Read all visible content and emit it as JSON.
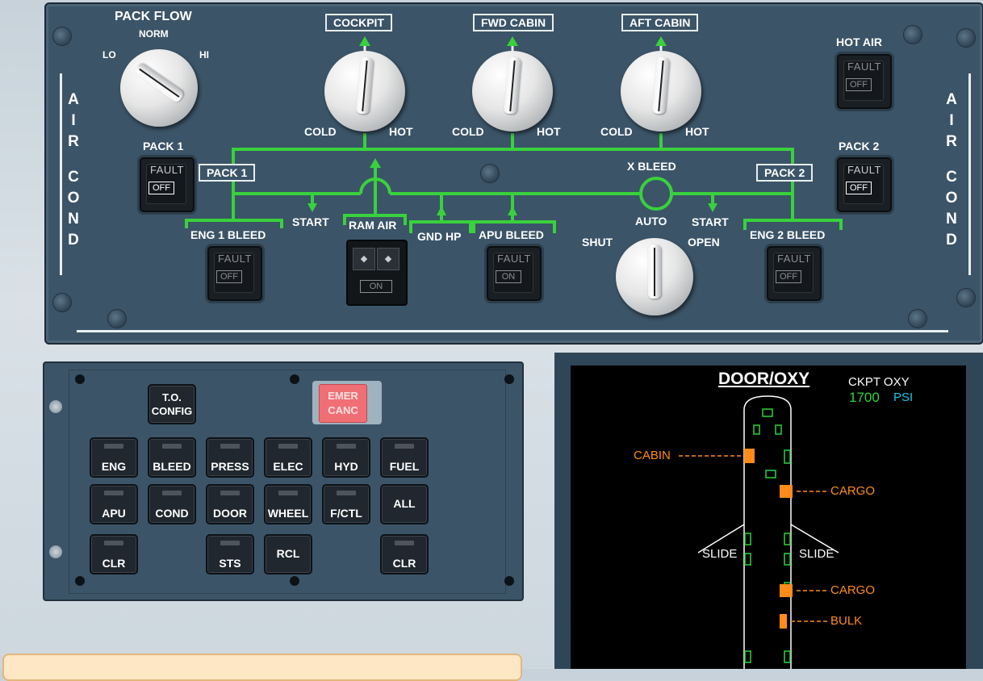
{
  "overhead": {
    "pack_flow": {
      "title": "PACK FLOW",
      "lo": "LO",
      "norm": "NORM",
      "hi": "HI"
    },
    "zones": [
      {
        "name": "COCKPIT",
        "cold": "COLD",
        "hot": "HOT"
      },
      {
        "name": "FWD CABIN",
        "cold": "COLD",
        "hot": "HOT"
      },
      {
        "name": "AFT CABIN",
        "cold": "COLD",
        "hot": "HOT"
      }
    ],
    "hot_air": {
      "label": "HOT AIR",
      "fault": "FAULT",
      "state": "OFF"
    },
    "pack1": {
      "label": "PACK 1",
      "fault": "FAULT",
      "state": "OFF",
      "box_label": "PACK 1"
    },
    "pack2": {
      "label": "PACK 2",
      "fault": "FAULT",
      "state": "OFF",
      "box_label": "PACK 2"
    },
    "side_left": [
      "A",
      "I",
      "R",
      "C",
      "O",
      "N",
      "D"
    ],
    "side_right": [
      "A",
      "I",
      "R",
      "C",
      "O",
      "N",
      "D"
    ],
    "x_bleed": {
      "label": "X BLEED",
      "shut": "SHUT",
      "auto": "AUTO",
      "open": "OPEN"
    },
    "start_left": "START",
    "start_right": "START",
    "eng1_bleed": {
      "label": "ENG 1 BLEED",
      "fault": "FAULT",
      "state": "OFF"
    },
    "ram_air": {
      "label": "RAM AIR",
      "state": "ON"
    },
    "gnd_hp": {
      "label": "GND HP"
    },
    "apu_bleed": {
      "label": "APU BLEED",
      "fault": "FAULT",
      "state": "ON"
    },
    "eng2_bleed": {
      "label": "ENG 2 BLEED",
      "fault": "FAULT",
      "state": "OFF"
    },
    "duct_color": "#39d13c"
  },
  "ecam_panel": {
    "to_config": [
      "T.O.",
      "CONFIG"
    ],
    "emer_canc": [
      "EMER",
      "CANC"
    ],
    "row1": [
      "ENG",
      "BLEED",
      "PRESS",
      "ELEC",
      "HYD",
      "FUEL"
    ],
    "row2": [
      "APU",
      "COND",
      "DOOR",
      "WHEEL",
      "F/CTL",
      "ALL"
    ],
    "row3": {
      "clr_left": "CLR",
      "sts": "STS",
      "rcl": "RCL",
      "clr_right": "CLR"
    }
  },
  "display": {
    "title": "DOOR/OXY",
    "ckpt_oxy_label": "CKPT OXY",
    "ckpt_oxy_value": "1700",
    "ckpt_oxy_unit": "PSI",
    "cabin": "CABIN",
    "cargo_fwd": "CARGO",
    "slide_left": "SLIDE",
    "slide_right": "SLIDE",
    "cargo_aft": "CARGO",
    "bulk": "BULK",
    "colors": {
      "green": "#2bd43a",
      "amber": "#ff8c1a",
      "cyan": "#19c7e6"
    }
  }
}
